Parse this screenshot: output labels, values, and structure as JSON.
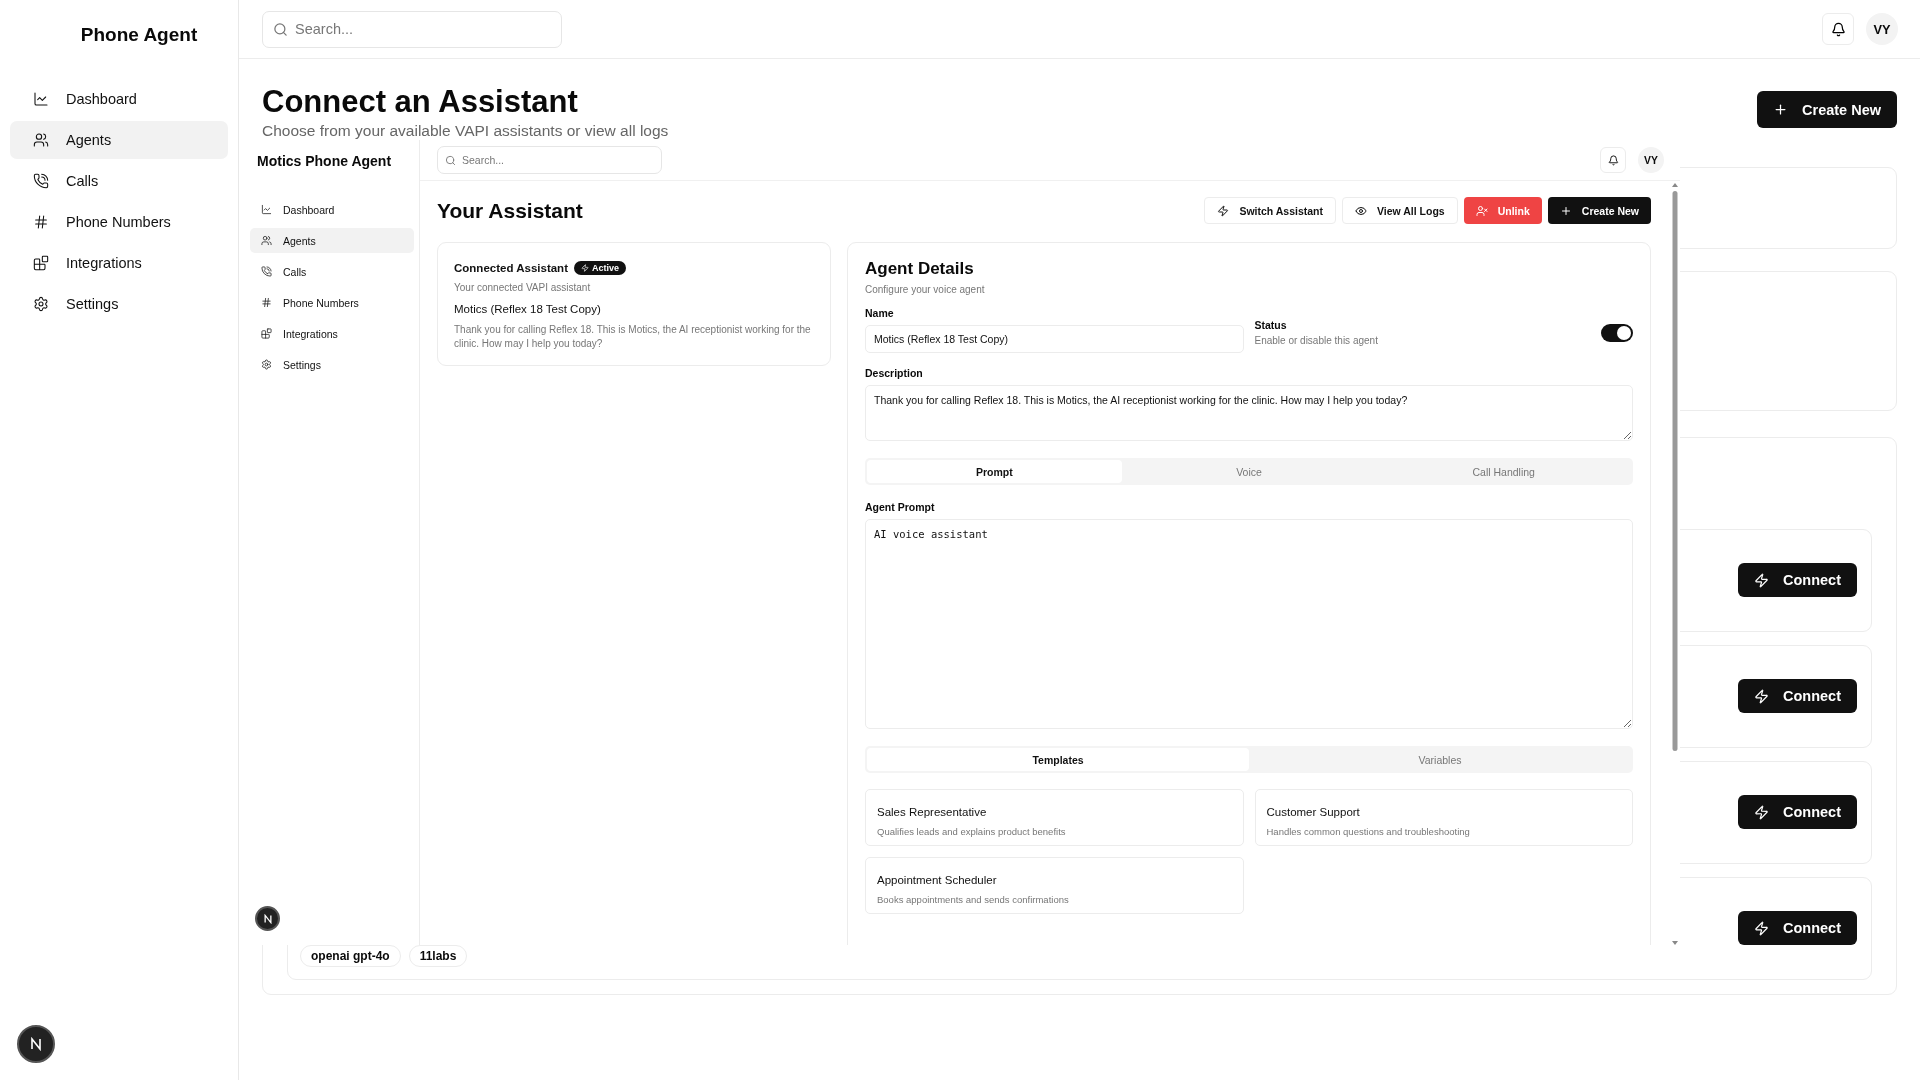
{
  "sidebar": {
    "title": "Phone Agent",
    "items": [
      {
        "label": "Dashboard",
        "selected": false
      },
      {
        "label": "Agents",
        "selected": true
      },
      {
        "label": "Calls",
        "selected": false
      },
      {
        "label": "Phone Numbers",
        "selected": false
      },
      {
        "label": "Integrations",
        "selected": false
      },
      {
        "label": "Settings",
        "selected": false
      }
    ]
  },
  "topbar": {
    "placeholder": "Search...",
    "avatar": "VY"
  },
  "header": {
    "title": "Connect an Assistant",
    "subtitle": "Choose from your available VAPI assistants or view all logs",
    "create_button": "Create New"
  },
  "assistant_list": {
    "connect_buttons": [
      "Connect",
      "Connect",
      "Connect",
      "Connect"
    ],
    "tags": [
      "openai gpt-4o",
      "11labs"
    ]
  },
  "embedded": {
    "sidebar": {
      "title": "Motics Phone Agent",
      "items": [
        {
          "label": "Dashboard",
          "selected": false
        },
        {
          "label": "Agents",
          "selected": true
        },
        {
          "label": "Calls",
          "selected": false
        },
        {
          "label": "Phone Numbers",
          "selected": false
        },
        {
          "label": "Integrations",
          "selected": false
        },
        {
          "label": "Settings",
          "selected": false
        }
      ]
    },
    "topbar": {
      "placeholder": "Search...",
      "avatar": "VY"
    },
    "title": "Your Assistant",
    "actions": [
      {
        "label": "Switch Assistant",
        "kind": "outline"
      },
      {
        "label": "View All Logs",
        "kind": "outline"
      },
      {
        "label": "Unlink",
        "kind": "danger"
      },
      {
        "label": "Create New",
        "kind": "primary"
      }
    ],
    "connected": {
      "title": "Connected Assistant",
      "badge": "Active",
      "subtitle": "Your connected VAPI assistant",
      "name": "Motics (Reflex 18 Test Copy)",
      "description": "Thank you for calling Reflex 18. This is Motics, the AI receptionist working for the clinic. How may I help you today?"
    },
    "details": {
      "title": "Agent Details",
      "subtitle": "Configure your voice agent",
      "name_label": "Name",
      "name_value": "Motics (Reflex 18 Test Copy)",
      "status_label": "Status",
      "status_hint": "Enable or disable this agent",
      "enabled": true,
      "description_label": "Description",
      "description_value": "Thank you for calling Reflex 18. This is Motics, the AI receptionist working for the clinic. How may I help you today?",
      "tabs": [
        {
          "label": "Prompt",
          "selected": true
        },
        {
          "label": "Voice",
          "selected": false
        },
        {
          "label": "Call Handling",
          "selected": false
        }
      ],
      "prompt_label": "Agent Prompt",
      "prompt_value": "AI voice assistant",
      "subtabs": [
        {
          "label": "Templates",
          "selected": true
        },
        {
          "label": "Variables",
          "selected": false
        }
      ],
      "templates": [
        {
          "title": "Sales Representative",
          "text": "Qualifies leads and explains product benefits"
        },
        {
          "title": "Customer Support",
          "text": "Handles common questions and troubleshooting"
        },
        {
          "title": "Appointment Scheduler",
          "text": "Books appointments and sends confirmations"
        }
      ]
    }
  }
}
